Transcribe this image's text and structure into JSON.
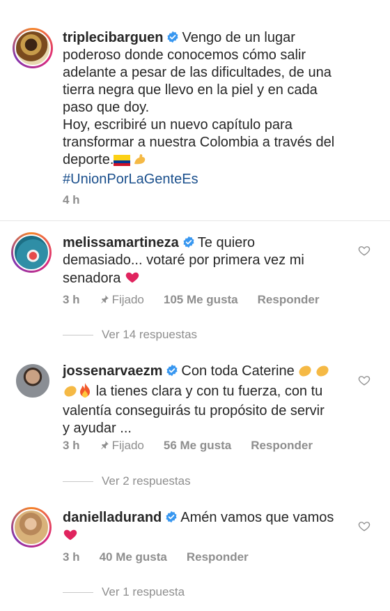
{
  "caption": {
    "username": "triplecibarguen",
    "line1": "Vengo de un lugar",
    "line2": "poderoso donde conocemos cómo salir",
    "line3": "adelante a pesar de las dificultades, de una",
    "line4": "tierra negra que llevo en la piel y en cada",
    "line5": "paso que doy.",
    "line6": "Hoy, escribiré un nuevo capítulo para",
    "line7": "transformar a nuestra Colombia a través del",
    "line8": "deporte.",
    "hashtag": "#UnionPorLaGenteEs",
    "time": "4 h"
  },
  "comments": [
    {
      "username": "melissamartineza",
      "line1": "Te quiero",
      "line2": "demasiado... votaré por primera vez mi",
      "line3": "senadora",
      "time": "3 h",
      "pinned": "Fijado",
      "likes": "105 Me gusta",
      "reply": "Responder",
      "view_replies": "Ver 14 respuestas"
    },
    {
      "username": "jossenarvaezm",
      "line1": "Con toda Caterine",
      "line2": "la tienes clara y con tu fuerza, con tu",
      "line3": "valentía  conseguirás tu propósito de servir",
      "line4": "y ayudar ...",
      "time": "3 h",
      "pinned": "Fijado",
      "likes": "56 Me gusta",
      "reply": "Responder",
      "view_replies": "Ver 2 respuestas"
    },
    {
      "username": "danielladurand",
      "line1": "Amén vamos que vamos",
      "time": "3 h",
      "likes": "40 Me gusta",
      "reply": "Responder",
      "view_replies": "Ver 1 respuesta"
    }
  ],
  "colors": {
    "text": "#262626",
    "meta": "#8e8e8e",
    "hashtag": "#1a4f8c",
    "verified": "#3897f0",
    "heart": "#e0245e"
  }
}
